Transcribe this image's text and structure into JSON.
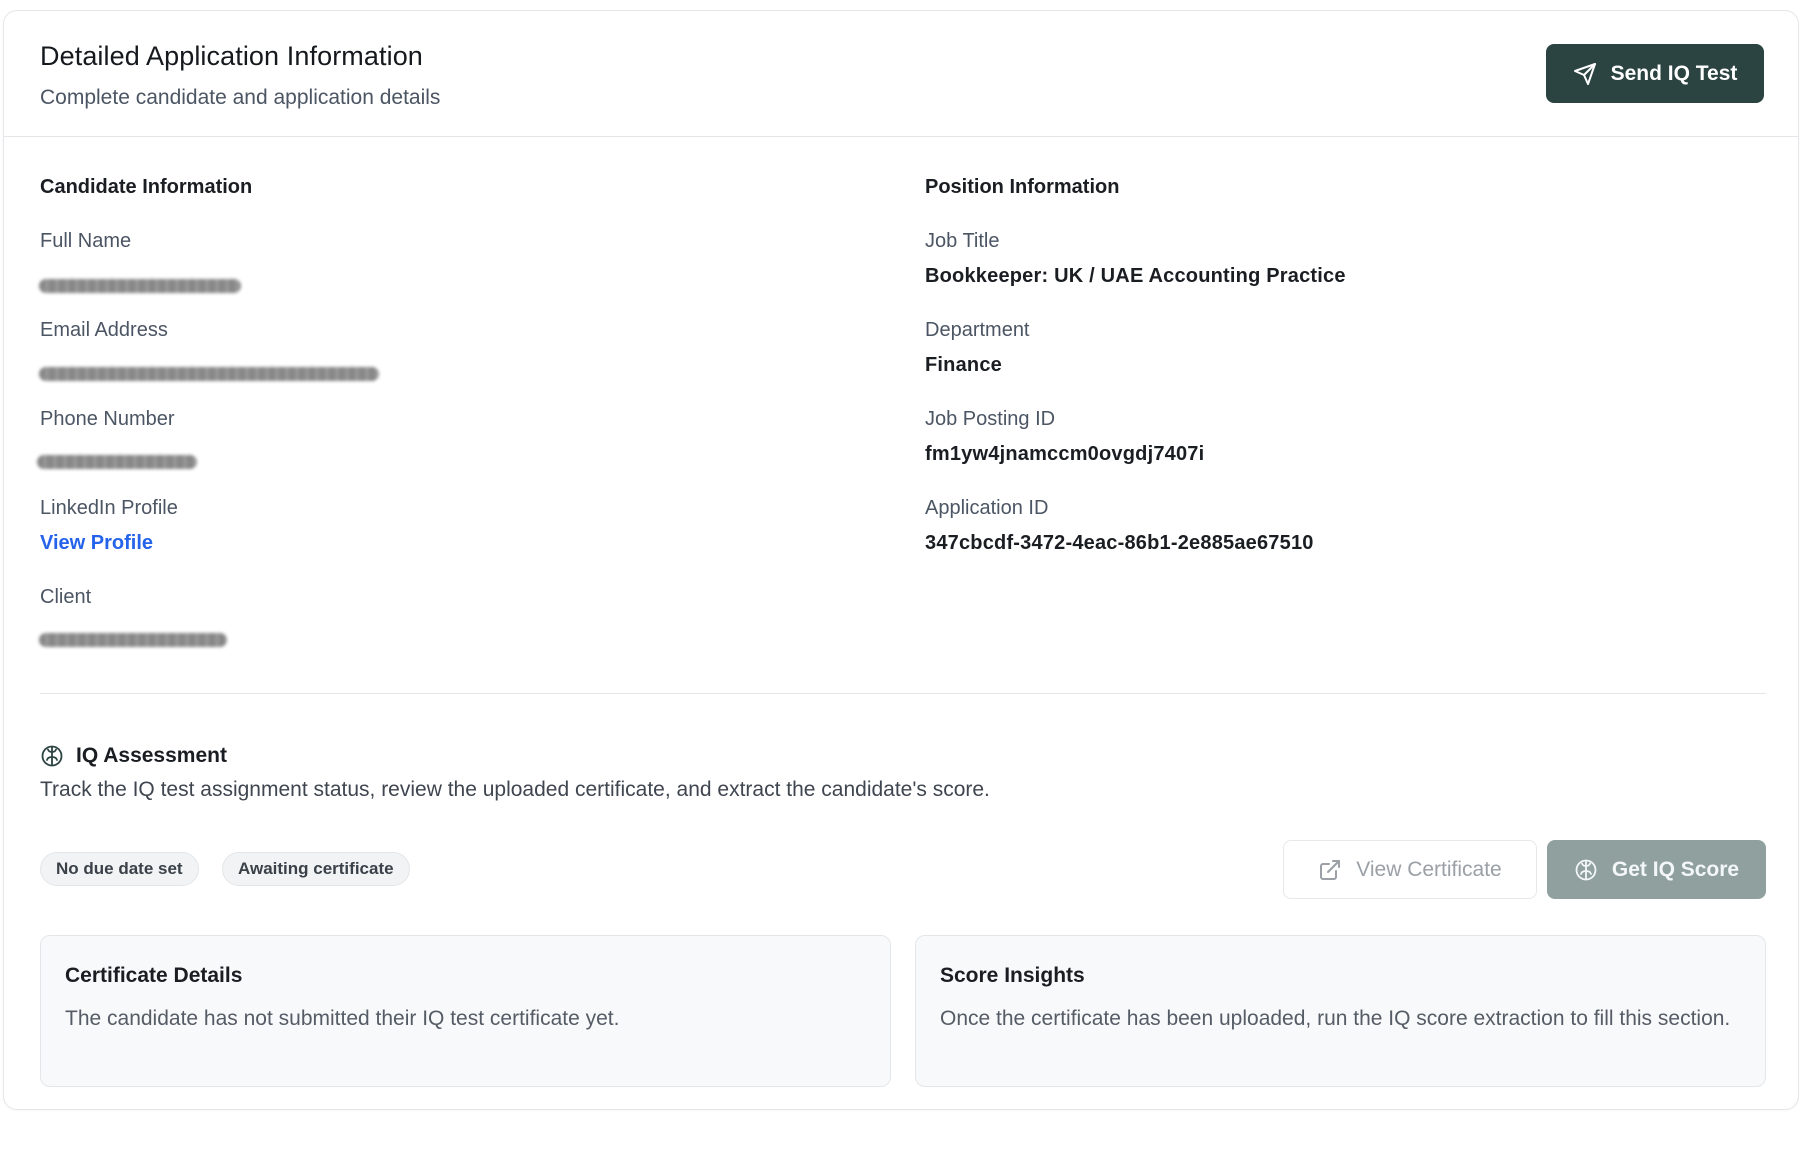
{
  "header": {
    "title": "Detailed Application Information",
    "subtitle": "Complete candidate and application details",
    "send_button_label": "Send IQ Test"
  },
  "candidate": {
    "section_title": "Candidate Information",
    "full_name_label": "Full Name",
    "email_label": "Email Address",
    "phone_label": "Phone Number",
    "linkedin_label": "LinkedIn Profile",
    "linkedin_link": "View Profile",
    "client_label": "Client"
  },
  "position": {
    "section_title": "Position Information",
    "job_title_label": "Job Title",
    "job_title_value": "Bookkeeper: UK / UAE Accounting Practice",
    "department_label": "Department",
    "department_value": "Finance",
    "job_posting_id_label": "Job Posting ID",
    "job_posting_id_value": "fm1yw4jnamccm0ovgdj7407i",
    "application_id_label": "Application ID",
    "application_id_value": "347cbcdf-3472-4eac-86b1-2e885ae67510"
  },
  "iq": {
    "title": "IQ Assessment",
    "description": "Track the IQ test assignment status, review the uploaded certificate, and extract the candidate's score.",
    "badges": [
      "No due date set",
      "Awaiting certificate"
    ],
    "view_certificate_label": "View Certificate",
    "get_score_label": "Get IQ Score",
    "certificate_panel": {
      "title": "Certificate Details",
      "text": "The candidate has not submitted their IQ test certificate yet."
    },
    "score_panel": {
      "title": "Score Insights",
      "text": "Once the certificate has been uploaded, run the IQ score extraction to fill this section."
    }
  },
  "colors": {
    "primary": "#2b4341",
    "primary_disabled": "#8fa09f",
    "link": "#2563eb"
  }
}
